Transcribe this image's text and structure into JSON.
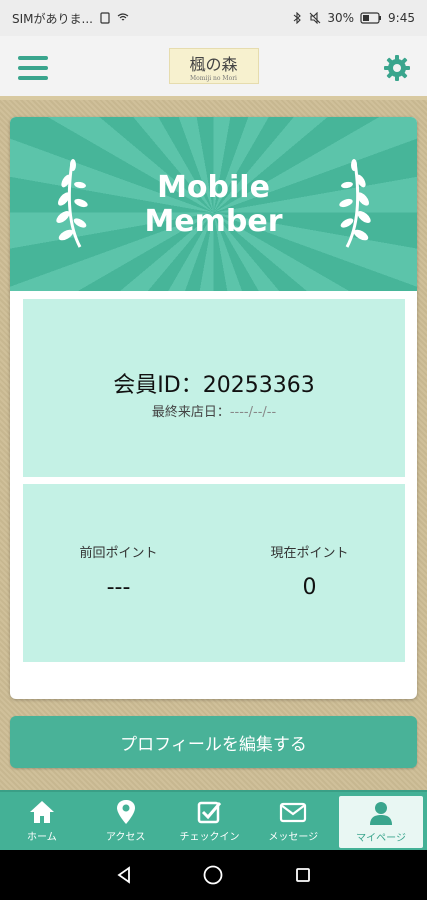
{
  "status_bar": {
    "carrier": "SIMがありま...",
    "battery": "30%",
    "time": "9:45"
  },
  "header": {
    "logo_text": "楓の森",
    "logo_sub": "Momiji no Mori"
  },
  "banner": {
    "line1": "Mobile",
    "line2": "Member"
  },
  "member": {
    "id_text": "会員ID：20253363",
    "last_visit_label": "最終来店日：",
    "last_visit_value": "----/--/--"
  },
  "points": {
    "previous_label": "前回ポイント",
    "previous_value": "---",
    "current_label": "現在ポイント",
    "current_value": "0"
  },
  "actions": {
    "edit_profile": "プロフィールを編集する"
  },
  "tabs": [
    {
      "label": "ホーム",
      "icon": "home-icon"
    },
    {
      "label": "アクセス",
      "icon": "map-pin-icon"
    },
    {
      "label": "チェックイン",
      "icon": "checkin-icon"
    },
    {
      "label": "メッセージ",
      "icon": "mail-icon"
    },
    {
      "label": "マイページ",
      "icon": "user-icon"
    }
  ],
  "active_tab": 4,
  "colors": {
    "accent": "#44b196",
    "panel": "#c4f1e5",
    "background": "#cdbd95"
  }
}
